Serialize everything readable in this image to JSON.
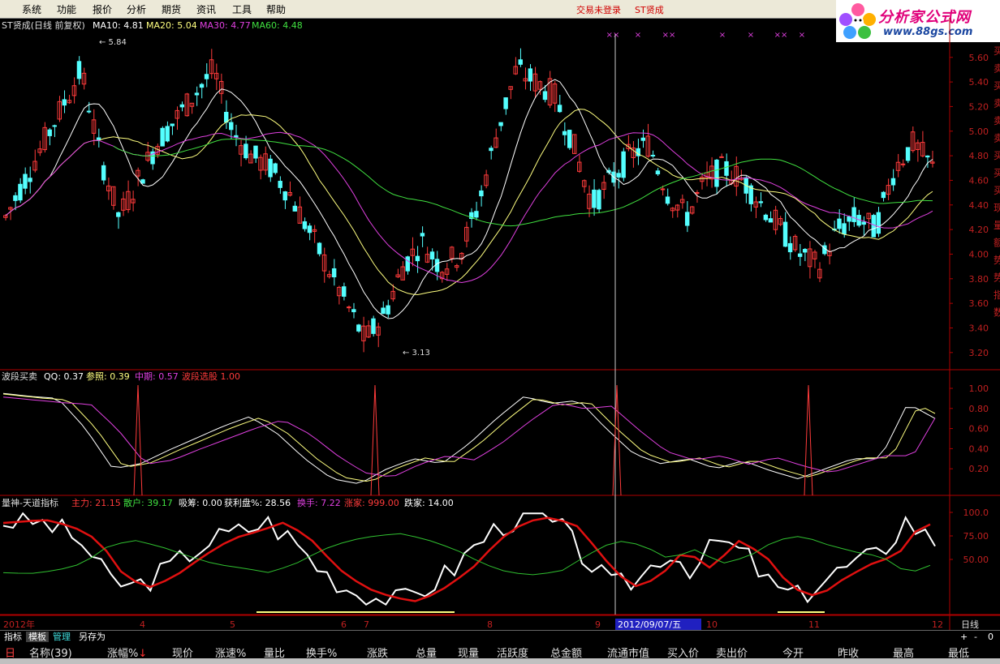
{
  "menu": [
    "系统",
    "功能",
    "报价",
    "分析",
    "期货",
    "资讯",
    "工具",
    "帮助"
  ],
  "status": {
    "login": "交易未登录",
    "stock": "ST贤成"
  },
  "logo": {
    "brand": "分析家公式网",
    "url": "www.88gs.com"
  },
  "colors": {
    "up": "#ff3b3b",
    "down": "#54ffff",
    "ma10": "#ffffff",
    "ma20": "#ffff80",
    "ma30": "#e040e0",
    "ma60": "#40e040",
    "axis": "#b00000"
  },
  "price_panel": {
    "title": "ST贤成(日线 前复权)",
    "ma10_label": "MA10:",
    "ma10": "4.81",
    "ma20_label": "MA20:",
    "ma20": "5.04",
    "ma30_label": "MA30:",
    "ma30": "4.77",
    "ma60_label": "MA60:",
    "ma60": "4.48",
    "y_ticks": [
      "5.60",
      "5.40",
      "5.20",
      "5.00",
      "4.80",
      "4.60",
      "4.40",
      "4.20",
      "4.00",
      "3.80",
      "3.60",
      "3.40",
      "3.20"
    ],
    "high_label": "5.84",
    "low_label": "3.13",
    "side_labels": [
      "买",
      "卖",
      "买",
      "卖",
      "卖",
      "卖",
      "买",
      "买",
      "买",
      "现",
      "量",
      "额",
      "势",
      "势",
      "指",
      "数"
    ],
    "x_markers": [
      "××",
      "×",
      "××",
      "×",
      "×",
      "××",
      "×"
    ]
  },
  "wave_panel": {
    "title": "波段买卖",
    "qq_label": "QQ:",
    "qq": "0.37",
    "ref_label": "参照:",
    "ref": "0.39",
    "mid_label": "中期:",
    "mid": "0.57",
    "pick_label": "波段选股",
    "pick": "1.00",
    "y_ticks": [
      "1.00",
      "0.80",
      "0.60",
      "0.40",
      "0.20"
    ]
  },
  "volume_panel": {
    "title": "量神-天道指标",
    "items": [
      {
        "label": "主力:",
        "value": "21.15"
      },
      {
        "label": "散户:",
        "value": "39.17"
      },
      {
        "label": "吸筹:",
        "value": "0.00"
      },
      {
        "label": "获利盘%:",
        "value": "28.56"
      },
      {
        "label": "换手:",
        "value": "7.22"
      },
      {
        "label": "涨家:",
        "value": "999.00"
      },
      {
        "label": "跌家:",
        "value": "14.00"
      }
    ],
    "y_ticks": [
      "100.0",
      "75.00",
      "50.00"
    ]
  },
  "x_axis": {
    "labels": [
      "2012年",
      "4",
      "5",
      "6",
      "7",
      "8",
      "9",
      "10",
      "11",
      "12"
    ],
    "cursor_date": "2012/09/07/五",
    "period": "日线"
  },
  "bottom_tabs": [
    "指标",
    "模板",
    "管理",
    "另存为"
  ],
  "controls": [
    "+",
    "-",
    "0"
  ],
  "columns": [
    "名称(39)",
    "涨幅%",
    "现价",
    "涨速%",
    "量比",
    "换手%",
    "涨跌",
    "总量",
    "现量",
    "活跃度",
    "总金额",
    "流通市值",
    "买入价",
    "卖出价",
    "今开",
    "昨收",
    "最高",
    "最低"
  ],
  "sort_arrow": "↓",
  "col_flag": "日",
  "chart_data": {
    "type": "candlestick",
    "symbol": "ST贤成",
    "period": "日线 前复权",
    "y_range": [
      3.13,
      5.84
    ],
    "x_range_months": [
      "2012年",
      "4",
      "5",
      "6",
      "7",
      "8",
      "9",
      "10",
      "11",
      "12"
    ],
    "ma": {
      "MA10": 4.81,
      "MA20": 5.04,
      "MA30": 4.77,
      "MA60": 4.48
    },
    "approx_close_trend": [
      4.3,
      4.6,
      4.9,
      5.2,
      5.5,
      4.8,
      4.3,
      4.6,
      4.9,
      5.1,
      5.3,
      5.5,
      5.0,
      4.8,
      4.7,
      4.5,
      4.2,
      3.9,
      3.6,
      3.3,
      3.5,
      3.9,
      4.1,
      3.9,
      4.0,
      4.4,
      5.0,
      5.5,
      5.4,
      5.3,
      4.9,
      4.4,
      4.6,
      4.8,
      4.9,
      4.5,
      4.3,
      4.6,
      4.7,
      4.6,
      4.4,
      4.2,
      4.0,
      3.9,
      4.2,
      4.3,
      4.2,
      4.7,
      4.9,
      4.7
    ]
  }
}
